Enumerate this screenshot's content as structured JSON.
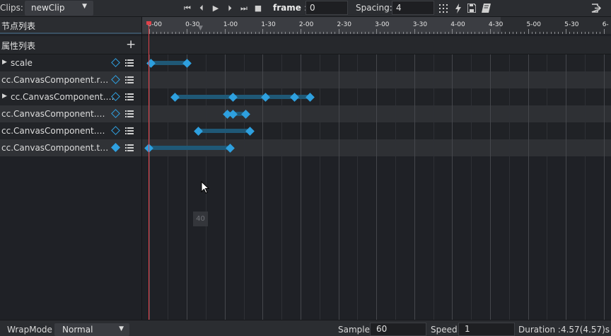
{
  "toolbar": {
    "clips_label": "Clips:",
    "clip_value": "newClip",
    "frame_label": "frame",
    "frame_sep": ":",
    "frame_value": "0",
    "spacing_label": "Spacing:",
    "spacing_value": "4"
  },
  "node_panel": {
    "title": "节点列表"
  },
  "prop_panel": {
    "title": "属性列表",
    "add_icon": "+"
  },
  "properties": [
    {
      "name": "scale",
      "expandable": true,
      "keyframe_filled": false
    },
    {
      "name": "cc.CanvasComponent.ren…",
      "expandable": false,
      "keyframe_filled": false
    },
    {
      "name": "cc.CanvasComponent.…",
      "expandable": true,
      "keyframe_filled": false
    },
    {
      "name": "cc.CanvasComponent.cle…",
      "expandable": false,
      "keyframe_filled": false
    },
    {
      "name": "cc.CanvasComponent.prio…",
      "expandable": false,
      "keyframe_filled": false
    },
    {
      "name": "cc.CanvasComponent.tar…",
      "expandable": false,
      "keyframe_filled": true
    }
  ],
  "ruler": {
    "ticks": [
      "0-00",
      "0-30",
      "1-00",
      "1-30",
      "2-00",
      "2-30",
      "3-00",
      "3-30",
      "4-00",
      "4-30",
      "5-00",
      "5-30",
      "6-"
    ]
  },
  "tracks": [
    {
      "keys": [
        0.11,
        2.12
      ]
    },
    {
      "keys": []
    },
    {
      "keys": [
        1.44,
        4.66,
        6.48,
        8.06,
        8.95
      ]
    },
    {
      "keys": [
        4.33,
        4.68,
        5.35
      ]
    },
    {
      "keys": [
        2.76,
        5.59
      ]
    },
    {
      "keys": [
        0.0,
        4.52
      ]
    }
  ],
  "hover_frame": "40",
  "footer": {
    "wrapmode_label": "WrapMode",
    "wrapmode_value": "Normal",
    "sample_label": "Sample",
    "sample_value": "60",
    "speed_label": "Speed",
    "speed_value": "1",
    "duration_text": "Duration :4.57(4.57)s"
  },
  "colors": {
    "accent": "#2ea0df",
    "segment": "#1f5876",
    "playhead": "#e0414a",
    "background": "#1f2126"
  }
}
